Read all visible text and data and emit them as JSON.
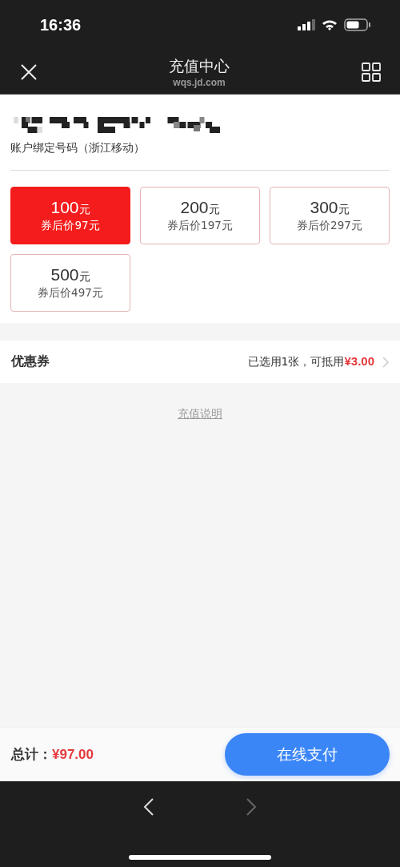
{
  "status_bar": {
    "time": "16:36"
  },
  "nav": {
    "title": "充值中心",
    "subtitle": "wqs.jd.com"
  },
  "account": {
    "label": "账户绑定号码（浙江移动）"
  },
  "options": [
    {
      "amount": "100",
      "unit": "元",
      "price": "券后价97元",
      "selected": true
    },
    {
      "amount": "200",
      "unit": "元",
      "price": "券后价197元",
      "selected": false
    },
    {
      "amount": "300",
      "unit": "元",
      "price": "券后价297元",
      "selected": false
    },
    {
      "amount": "500",
      "unit": "元",
      "price": "券后价497元",
      "selected": false
    }
  ],
  "coupon": {
    "label": "优惠券",
    "summary": "已选用1张，可抵用",
    "amount": "¥3.00"
  },
  "info_link": "充值说明",
  "footer": {
    "total_label": "总计：",
    "total": "¥97.00",
    "pay_button": "在线支付"
  },
  "browser_nav": [
    {
      "kind": "back",
      "disabled": false
    },
    {
      "kind": "forward",
      "disabled": true
    }
  ]
}
